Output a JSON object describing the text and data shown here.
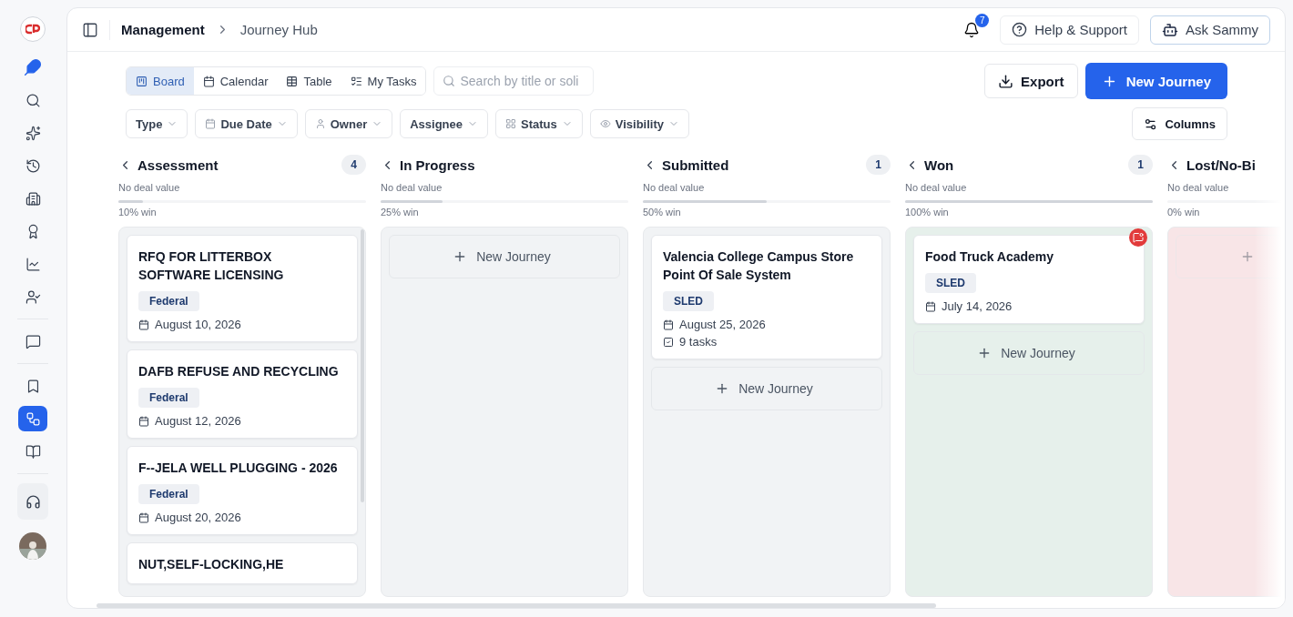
{
  "sidebar": {
    "items": [
      {
        "selected": false
      },
      {
        "selected": false
      },
      {
        "selected": false
      },
      {
        "selected": false
      },
      {
        "selected": false
      },
      {
        "selected": false
      },
      {
        "selected": false
      },
      {
        "selected": false
      },
      {
        "selected": false
      },
      {
        "selected": false
      },
      {
        "selected": true
      },
      {
        "selected": false
      }
    ]
  },
  "breadcrumb": [
    "Management",
    "Journey Hub"
  ],
  "header": {
    "notifications": "7",
    "help": "Help & Support",
    "assistant": "Ask Sammy"
  },
  "views": [
    {
      "label": "Board",
      "selected": true
    },
    {
      "label": "Calendar",
      "selected": false
    },
    {
      "label": "Table",
      "selected": false
    },
    {
      "label": "My Tasks",
      "selected": false
    }
  ],
  "search": {
    "placeholder": "Search by title or soli"
  },
  "actions": {
    "export": "Export",
    "new": "New Journey",
    "columns": "Columns"
  },
  "filters": [
    "Type",
    "Due Date",
    "Owner",
    "Assignee",
    "Status",
    "Visibility"
  ],
  "board": {
    "columns": [
      {
        "title": "Assessment",
        "count": "4",
        "deal": "No deal value",
        "level": 0.1,
        "win": "10% win",
        "color": "#f1f3f5",
        "cards": [
          {
            "title": "RFQ FOR LITTERBOX SOFTWARE LICENSING",
            "tag": "Federal",
            "date": "August 10, 2026",
            "alert": false
          },
          {
            "title": "DAFB REFUSE AND RECYCLING",
            "tag": "Federal",
            "date": "August 12, 2026",
            "alert": false
          },
          {
            "title": "F--JELA WELL PLUGGING - 2026",
            "tag": "Federal",
            "date": "August 20, 2026",
            "alert": false
          },
          {
            "title": "NUT,SELF-LOCKING,HE",
            "alert": false
          }
        ]
      },
      {
        "title": "In Progress",
        "deal": "No deal value",
        "level": 0.25,
        "win": "25% win",
        "color": "#f1f3f5",
        "add": "New Journey"
      },
      {
        "title": "Submitted",
        "count": "1",
        "deal": "No deal value",
        "level": 0.5,
        "win": "50% win",
        "color": "#f1f3f5",
        "cards": [
          {
            "title": "Valencia College Campus Store Point Of Sale System",
            "tag": "SLED",
            "date": "August 25, 2026",
            "tasks": "9 tasks",
            "alert": false
          }
        ],
        "add": "New Journey"
      },
      {
        "title": "Won",
        "count": "1",
        "deal": "No deal value",
        "level": 1,
        "win": "100% win",
        "color": "#e6f0eb",
        "cards": [
          {
            "title": "Food Truck Academy",
            "tag": "SLED",
            "date": "July 14, 2026",
            "alert": true
          }
        ],
        "add": "New Journey"
      },
      {
        "title": "Lost/No-Bi",
        "deal": "No deal value",
        "level": 0,
        "win": "0% win",
        "color": "#f8e5e7",
        "add_icon": true
      }
    ]
  }
}
